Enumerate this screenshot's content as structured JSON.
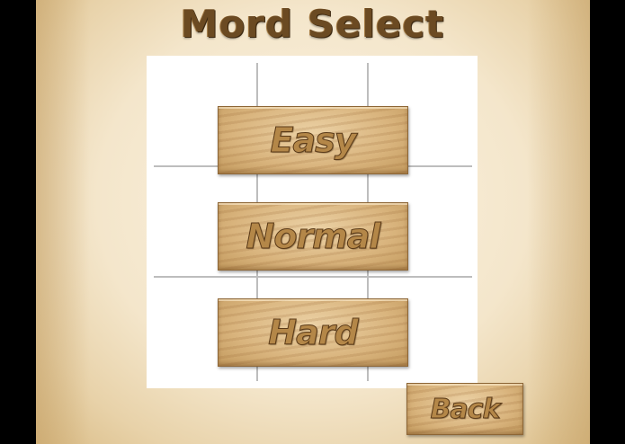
{
  "title": "Mord Select",
  "difficulties": [
    {
      "label": "Easy"
    },
    {
      "label": "Normal"
    },
    {
      "label": "Hard"
    }
  ],
  "back_label": "Back",
  "colors": {
    "background": "#000000",
    "parchment": "#f4e6cb",
    "title_text": "#6b4a22",
    "panel": "#ffffff",
    "grid_line": "#bdbdbd",
    "wood": "#d9b47d",
    "wood_text_outline": "#5a3a18"
  }
}
